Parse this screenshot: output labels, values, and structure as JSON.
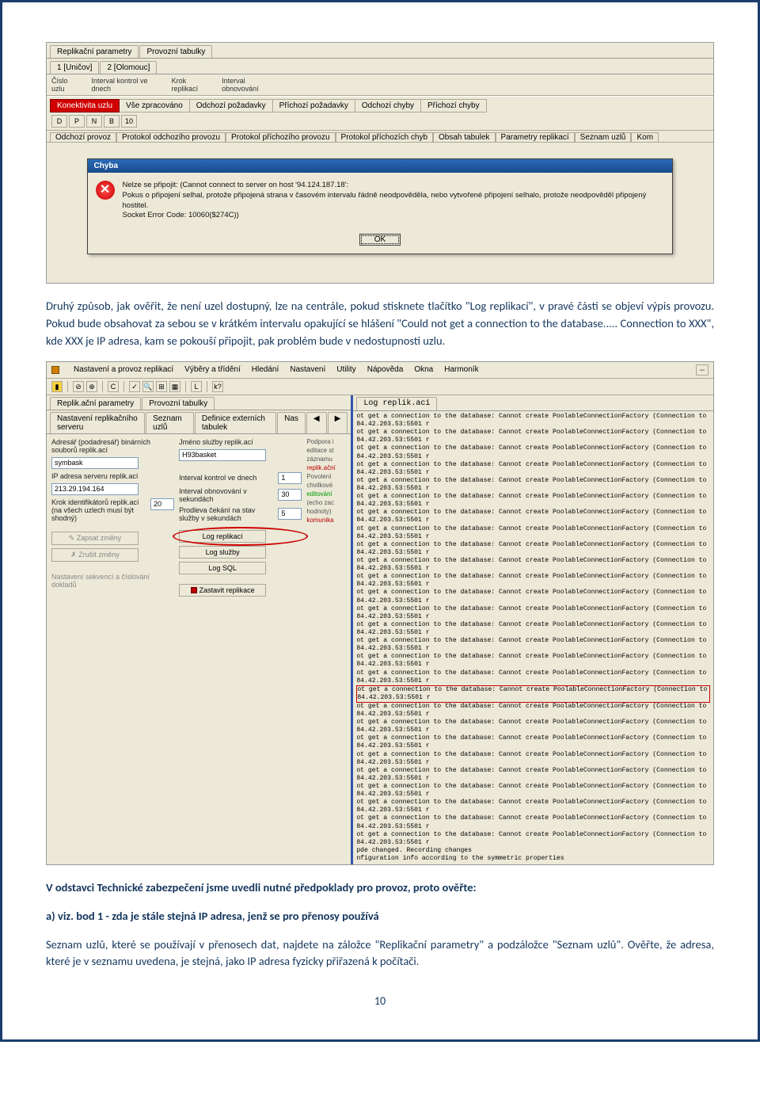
{
  "shot1": {
    "tabs": [
      "Replikační parametry",
      "Provozní tabulky"
    ],
    "subtabs": [
      "1 [Uničov]",
      "2 [Olomouc]"
    ],
    "headers": [
      {
        "l1": "Číslo",
        "l2": "uzlu"
      },
      {
        "l1": "Interval kontrol ve",
        "l2": "dnech"
      },
      {
        "l1": "Krok",
        "l2": "replikací"
      },
      {
        "l1": "Interval",
        "l2": "obnovování"
      }
    ],
    "statusTabs": [
      "Konektivita uzlu",
      "Vše zpracováno",
      "Odchozí požadavky",
      "Příchozí požadavky",
      "Odchozí chyby",
      "Příchozí chyby"
    ],
    "tbBtns": [
      "D",
      "P",
      "N",
      "B",
      "10"
    ],
    "innerTabs": [
      "Odchozí provoz",
      "Protokol odchozího provozu",
      "Protokol příchozího provozu",
      "Protokol příchozích chyb",
      "Obsah tabulek",
      "Parametry replikací",
      "Seznam uzlů",
      "Kom"
    ],
    "errTitle": "Chyba",
    "errMsg1": "Nelze se připojit: (Cannot connect to server on host '94.124.187.18':",
    "errMsg2": "Pokus o připojení selhal, protože připojená strana v časovém intervalu řádně neodpověděla, nebo vytvořené připojení selhalo, protože neodpověděl připojený hostitel.",
    "errMsg3": "Socket Error Code: 10060($274C))",
    "okBtn": "OK"
  },
  "para1": "Druhý způsob, jak ověřit, že není uzel dostupný, lze na centrále, pokud stisknete tlačítko \"Log replikací\", v pravé části se objeví výpis provozu. Pokud bude obsahovat za sebou se v krátkém intervalu opakující se hlášení \"Could not get a connection to the database..... Connection to XXX\", kde XXX je IP adresa, kam se pokouší připojit, pak problém bude v nedostupnosti uzlu.",
  "shot2": {
    "menu": [
      "Nastavení a provoz replikací",
      "Výběry a třídění",
      "Hledání",
      "Nastavení",
      "Utility",
      "Nápověda",
      "Okna",
      "Harmoník"
    ],
    "leftTab1": [
      "Replik.ační parametry",
      "Provozní tabulky"
    ],
    "leftTab2": [
      "Nastavení replikačního serveru",
      "Seznam uzlů",
      "Definice externích tabulek",
      "Nas"
    ],
    "lbl_adr": "Adresář (podadresář) binárních souborů replik.ací",
    "val_adr": "symbask",
    "lbl_ip": "IP adresa serveru replik.ací",
    "val_ip": "213.29.194.164",
    "lbl_krok": "Krok identifikátorů replik.ací (na všech uzlech musí být shodný)",
    "val_krok": "20",
    "lbl_jmeno": "Jméno služby replik.ací",
    "val_jmeno": "H93basket",
    "lbl_intkon": "Interval kontrol ve dnech",
    "val_intkon": "1",
    "lbl_intobn": "Interval obnovování v sekundách",
    "val_intobn": "30",
    "lbl_prodl": "Prodleva čekání na stav služby v sekundách",
    "val_prodl": "5",
    "btn_zapsat": "Zapsat změny",
    "btn_log": "Log replikací",
    "btn_zrusit": "Zrušit změny",
    "btn_logsluz": "Log služby",
    "btn_logsql": "Log SQL",
    "btn_zastavit": "Zastavit replikace",
    "lbl_seq": "Nastavení sekvencí a číslování dokladů",
    "sidebar": [
      "Podpora i",
      "editace st",
      "záznamu",
      "replik.ační",
      "Povolení",
      "chvilkové",
      "editování",
      "(echo zac",
      "hodnoty)",
      "komunika"
    ],
    "rightTab": "Log replik.ací",
    "logline": "ot get a connection to the database: Cannot create PoolableConnectionFactory (Connection to 84.42.203.53:5501 r",
    "tail1": "pde changed. Recording changes",
    "tail2": "nfiguration info according to the symmetric properties"
  },
  "sec_title": "V odstavci Technické zabezpečení jsme uvedli nutné předpoklady pro provoz, proto ověřte:",
  "item_a": "a) viz. bod 1 - zda je stále stejná IP adresa, jenž se pro přenosy používá",
  "para2": "Seznam uzlů, které se používají v přenosech dat, najdete na záložce \"Replikační parametry\" a podzáložce \"Seznam uzlů\". Ověřte, že adresa, které je v seznamu uvedena, je stejná, jako IP adresa fyzicky přiřazená k počítači.",
  "pageNum": "10"
}
